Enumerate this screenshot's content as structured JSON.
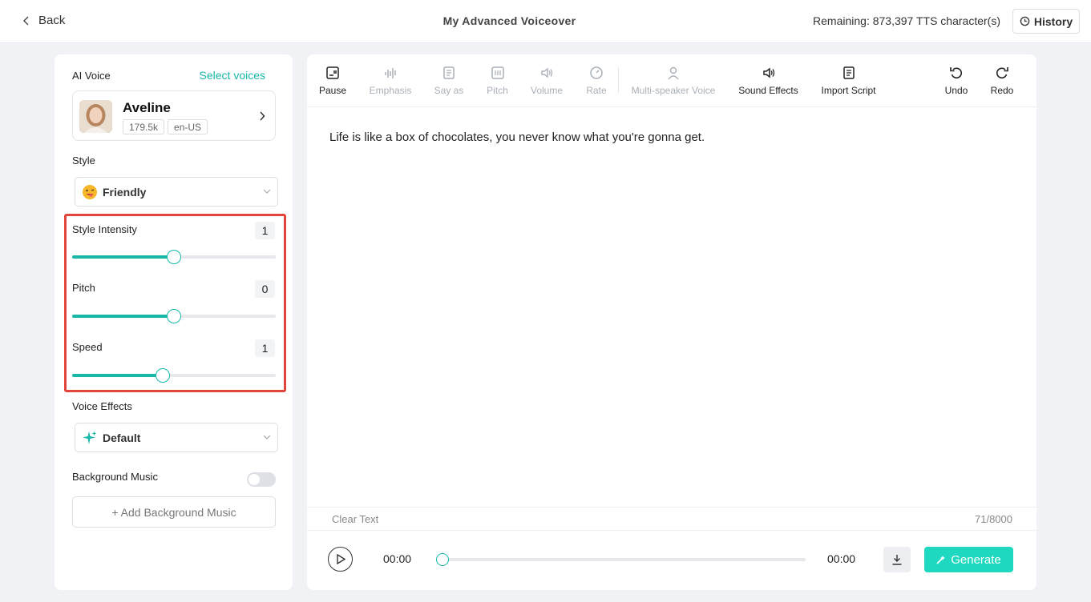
{
  "header": {
    "back_label": "Back",
    "title": "My Advanced Voiceover",
    "remaining": "Remaining: 873,397 TTS character(s)",
    "history_label": "History"
  },
  "left": {
    "ai_voice_label": "AI Voice",
    "select_voices_label": "Select voices",
    "voice": {
      "name": "Aveline",
      "uses": "179.5k",
      "locale": "en-US"
    },
    "style_label": "Style",
    "style_value": "Friendly",
    "sliders": [
      {
        "label": "Style Intensity",
        "value": "1",
        "fraction": 0.5
      },
      {
        "label": "Pitch",
        "value": "0",
        "fraction": 0.5
      },
      {
        "label": "Speed",
        "value": "1",
        "fraction": 0.445
      }
    ],
    "voice_effects_label": "Voice Effects",
    "voice_effects_value": "Default",
    "bg_music_label": "Background Music",
    "bg_music_enabled": false,
    "add_bg_music_label": "+ Add Background Music"
  },
  "toolbar": {
    "pause": "Pause",
    "emphasis": "Emphasis",
    "say_as": "Say as",
    "pitch": "Pitch",
    "volume": "Volume",
    "rate": "Rate",
    "multi_speaker": "Multi-speaker Voice",
    "sound_effects": "Sound Effects",
    "import_script": "Import Script",
    "undo": "Undo",
    "redo": "Redo"
  },
  "editor": {
    "text": "Life is like a box of chocolates, you never know what you're gonna get.",
    "clear_label": "Clear Text",
    "char_count": "71/8000"
  },
  "player": {
    "current_time": "00:00",
    "total_time": "00:00",
    "progress": 0,
    "generate_label": "Generate"
  },
  "colors": {
    "accent": "#17b8a8",
    "generate": "#1ed9c0",
    "highlight": "#e0443b"
  }
}
